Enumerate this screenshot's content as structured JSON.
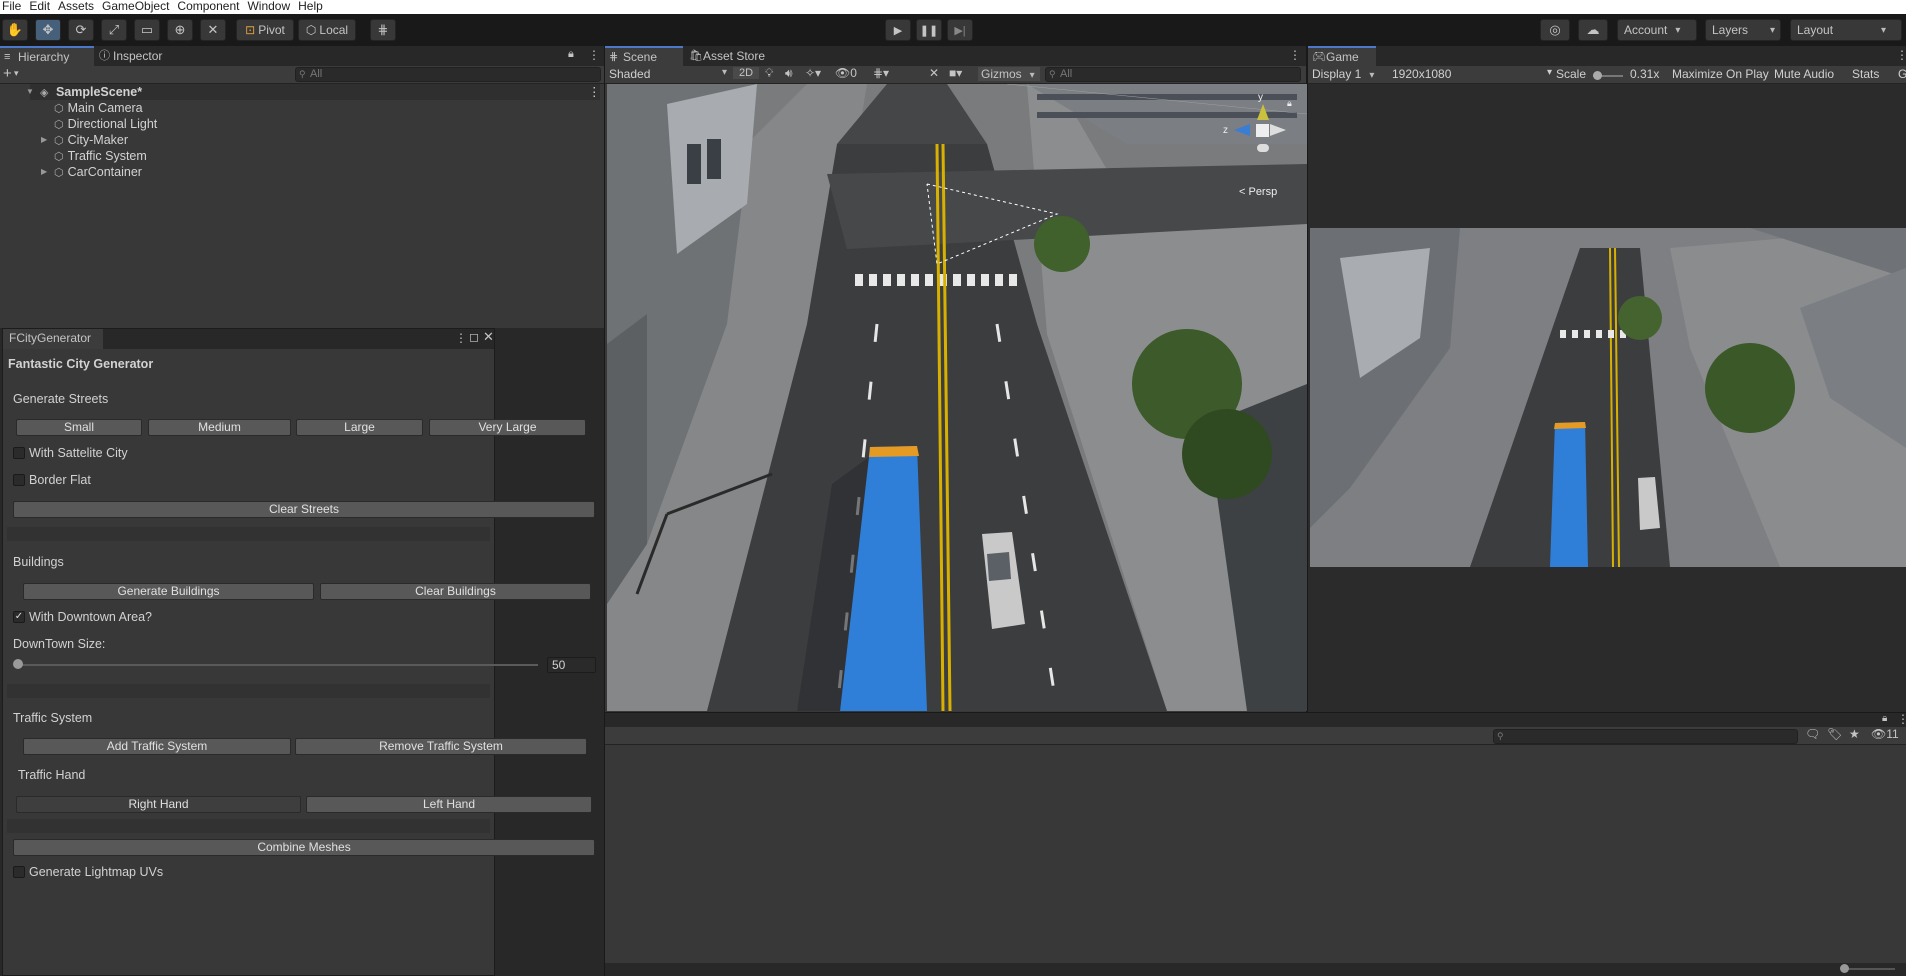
{
  "menu": [
    "File",
    "Edit",
    "Assets",
    "GameObject",
    "Component",
    "Window",
    "Help"
  ],
  "toolbar": {
    "pivot": "Pivot",
    "local": "Local",
    "account": "Account",
    "layers": "Layers",
    "layout": "Layout"
  },
  "hierarchy": {
    "tab": "Hierarchy",
    "inspector_tab": "Inspector",
    "search_placeholder": "All",
    "scene_name": "SampleScene*",
    "items": [
      "Main Camera",
      "Directional Light",
      "City-Maker",
      "Traffic System",
      "CarContainer"
    ]
  },
  "scene": {
    "tab": "Scene",
    "asset_store_tab": "Asset Store",
    "shading": "Shaded",
    "mode_2d": "2D",
    "hidden_count": "0",
    "gizmos": "Gizmos",
    "search_placeholder": "All",
    "persp": "< Persp",
    "axis_y": "y",
    "axis_z": "z"
  },
  "game": {
    "tab": "Game",
    "display": "Display 1",
    "resolution": "1920x1080",
    "scale_label": "Scale",
    "scale_value": "0.31x",
    "maximize": "Maximize On Play",
    "mute": "Mute Audio",
    "stats": "Stats",
    "gizmos_short": "G"
  },
  "fcity": {
    "tab": "FCityGenerator",
    "title": "Fantastic City Generator",
    "streets": {
      "header": "Generate Streets",
      "sizes": [
        "Small",
        "Medium",
        "Large",
        "Very Large"
      ],
      "satellite": "With Sattelite City",
      "border_flat": "Border Flat",
      "clear": "Clear Streets"
    },
    "buildings": {
      "header": "Buildings",
      "generate": "Generate Buildings",
      "clear": "Clear Buildings",
      "downtown_check": "With Downtown Area?",
      "downtown_size_label": "DownTown Size:",
      "downtown_size": "50"
    },
    "traffic": {
      "header": "Traffic System",
      "add": "Add Traffic System",
      "remove": "Remove Traffic System",
      "hand_header": "Traffic Hand",
      "right": "Right Hand",
      "left": "Left Hand"
    },
    "combine": "Combine Meshes",
    "lightmap": "Generate Lightmap UVs"
  },
  "console": {
    "count": "11"
  },
  "colors": {
    "accent": "#4b78c8",
    "bus": "#2f7fd8",
    "road": "#3a3a3c"
  }
}
